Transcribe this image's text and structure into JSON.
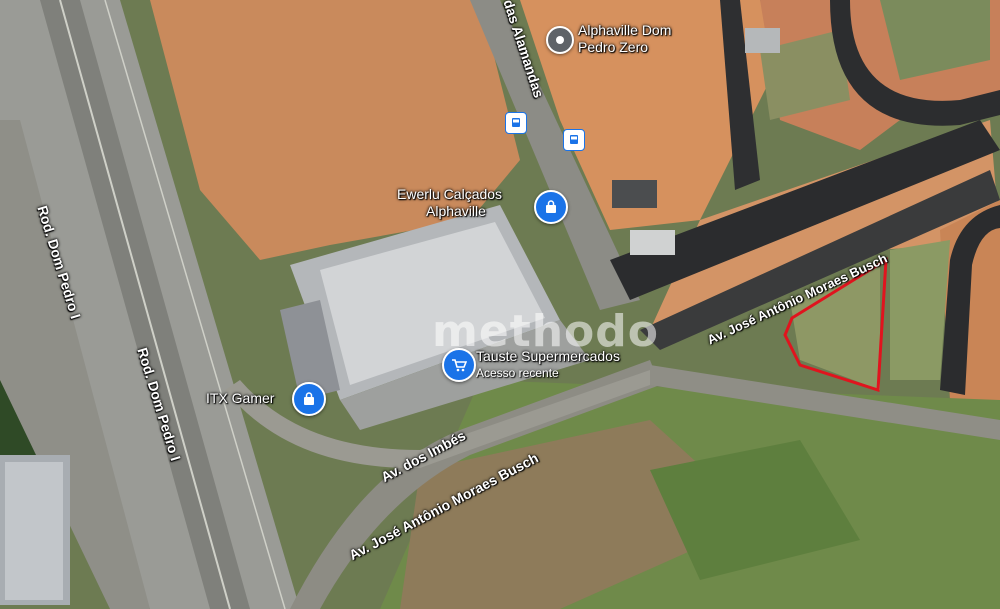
{
  "pois": {
    "alphaville": {
      "line1": "Alphaville Dom",
      "line2": "Pedro Zero",
      "icon": "place-icon"
    },
    "ewerlu": {
      "line1": "Ewerlu Calçados",
      "line2": "Alphaville",
      "icon": "shopping-bag-icon"
    },
    "tauste": {
      "line1": "Tauste Supermercados",
      "line2": "Acesso recente",
      "icon": "shopping-cart-icon"
    },
    "itx": {
      "line1": "ITX Gamer",
      "icon": "shopping-bag-icon"
    }
  },
  "roads": {
    "rod_dom_pedro_1": "Rod. Dom Pedro I",
    "rod_dom_pedro_2": "Rod. Dom Pedro I",
    "alamandas": "das Alamandas",
    "imbes": "Av. dos Imbés",
    "jose_antonio_1": "Av. José Antônio Moraes Busch",
    "jose_antonio_2": "Av. José Antônio Moraes Busch"
  },
  "watermark": "methodo",
  "colors": {
    "highlight_outline": "#e0141e",
    "pin_blue": "#1a73e8",
    "pin_gray": "#5f6368"
  }
}
